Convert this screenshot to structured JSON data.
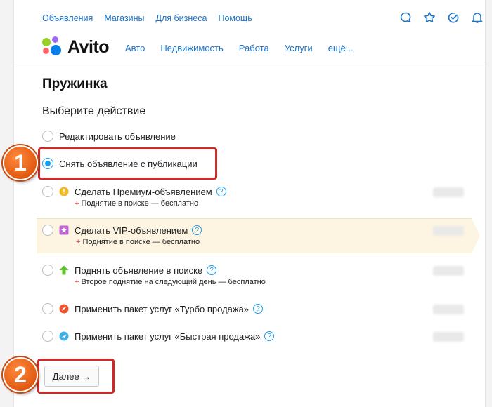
{
  "top_nav": [
    "Объявления",
    "Магазины",
    "Для бизнеса",
    "Помощь"
  ],
  "top_icons": [
    "chat-icon",
    "star-icon",
    "notification-icon",
    "bell-icon"
  ],
  "logo": {
    "text": "Avito",
    "dot_colors": [
      "#97cf26",
      "#a169f7",
      "#ff6163",
      "#0a7ee8"
    ]
  },
  "main_nav": [
    "Авто",
    "Недвижимость",
    "Работа",
    "Услуги",
    "ещё..."
  ],
  "page_title": "Пружинка",
  "subtitle": "Выберите действие",
  "options": [
    {
      "label": "Редактировать объявление",
      "checked": false,
      "icon": null
    },
    {
      "label": "Снять объявление с публикации",
      "checked": true,
      "icon": null
    },
    {
      "label": "Сделать Премиум-объявлением",
      "checked": false,
      "icon": "premium-icon",
      "help": "?",
      "perk": "Поднятие в поиске — бесплатно"
    },
    {
      "label": "Сделать VIP-объявлением",
      "checked": false,
      "icon": "vip-icon",
      "help": "?",
      "perk": "Поднятие в поиске — бесплатно"
    },
    {
      "label": "Поднять объявление в поиске",
      "checked": false,
      "icon": "arrow-up-icon",
      "help": "?",
      "perk": "Второе поднятие на следующий день — бесплатно"
    },
    {
      "label": "Применить пакет услуг «Турбо продажа»",
      "checked": false,
      "icon": "turbo-icon",
      "help": "?"
    },
    {
      "label": "Применить пакет услуг «Быстрая продажа»",
      "checked": false,
      "icon": "fast-sale-icon",
      "help": "?"
    }
  ],
  "perk_prefix": "+",
  "callouts": [
    "1",
    "2"
  ],
  "next_button": "Далее →",
  "colors": {
    "link": "#1a73c8",
    "radio_active": "#1a9df2",
    "callout": "#cf2a2a",
    "vip_bg": "#fdf5e2"
  }
}
